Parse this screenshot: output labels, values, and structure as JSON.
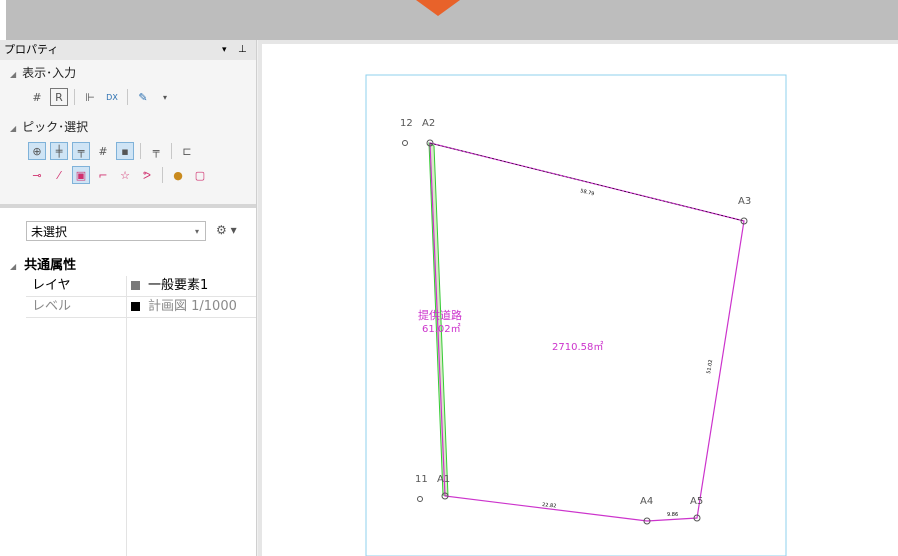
{
  "panel": {
    "title": "プロパティ",
    "dropdown_icon": "▾",
    "pin_icon": "ꟸ"
  },
  "groups": {
    "display_input": "表示･入力",
    "pick_select": "ピック･選択"
  },
  "selector": {
    "value": "未選択"
  },
  "properties": {
    "section_title": "共通属性",
    "rows": [
      {
        "key": "レイヤ",
        "value": "一般要素1",
        "swatch": "#7a7a7a"
      },
      {
        "key": "レベル",
        "value": "計画図 1/1000",
        "swatch": "#000000"
      }
    ]
  },
  "drawing": {
    "area_label": "2710.58㎡",
    "road_label_1": "提供道路",
    "road_label_2": "61.02㎡",
    "point_12": "12",
    "point_a2": "A2",
    "point_a3": "A3",
    "point_11": "11",
    "point_a1": "A1",
    "point_a4": "A4",
    "point_a5": "A5",
    "dim_top": "58.79",
    "dim_right": "51.02",
    "dim_bottom": "22.82",
    "dim_bottom2": "9.86",
    "line_color": "#cc33cc",
    "road_color": "#33cc33"
  }
}
